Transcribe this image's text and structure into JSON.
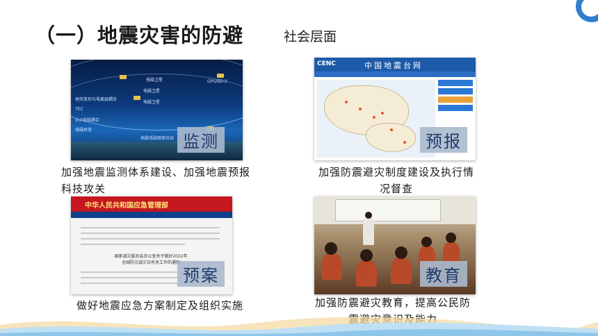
{
  "header": {
    "title": "（一）地震灾害的防避",
    "subtitle": "社会层面"
  },
  "panels": [
    {
      "badge": "监测",
      "caption": "加强地震监测体系建设、加强地震预报科技攻关",
      "image_labels": [
        "电磁卫星",
        "GPS/BD-2",
        "电磁卫星",
        "电磁卫星",
        "地壳变形与电离层耦合",
        "TEC",
        "VLF电磁耦合",
        "电磁异常",
        "地震电磁观测台站"
      ]
    },
    {
      "badge": "预报",
      "caption": "加强防震避灾制度建设及执行情况督查",
      "site_logo": "CENC",
      "site_title": "中国地震台网"
    },
    {
      "badge": "预案",
      "caption": "做好地震应急方案制定及组织实施",
      "site_title": "中华人民共和国应急管理部",
      "doc_title": "国家减灾委员会办公室关于做好2022年全国防灾减灾日有关工作的通知"
    },
    {
      "badge": "教育",
      "caption": "加强防震避灾教育，提高公民防震避灾意识及能力"
    }
  ],
  "colors": {
    "accent": "#2f7fd0",
    "badge_bg": "#aab9cd",
    "badge_text": "#1f3b6a"
  }
}
